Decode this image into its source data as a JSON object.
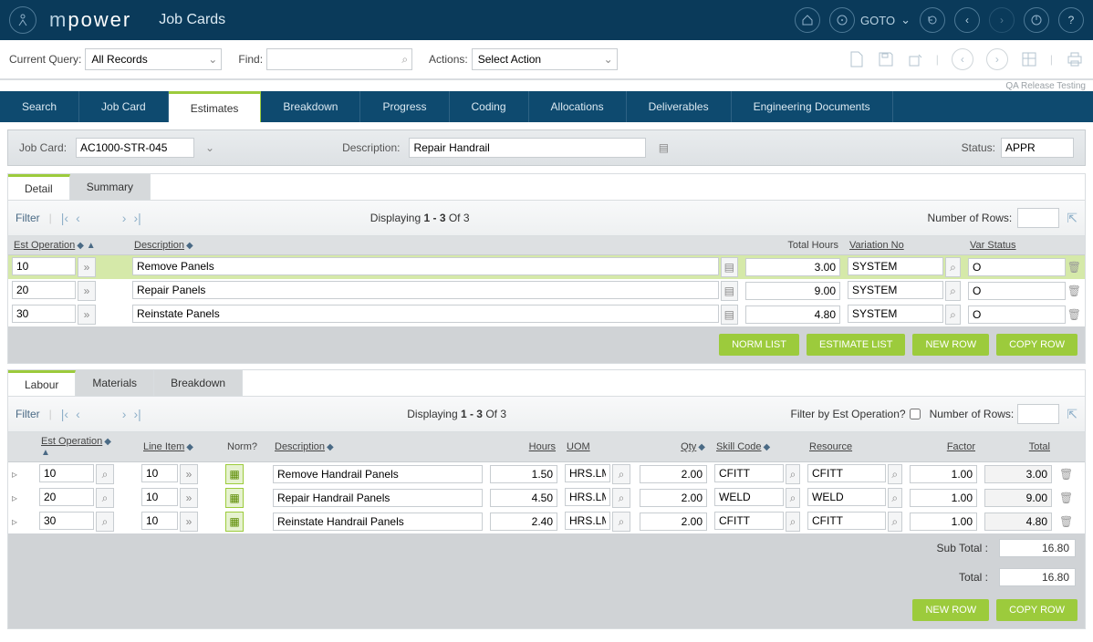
{
  "header": {
    "brand_prefix": "m",
    "brand": "power",
    "page_title": "Job Cards",
    "goto_label": "GOTO"
  },
  "querybar": {
    "current_query_label": "Current Query:",
    "current_query_value": "All Records",
    "find_label": "Find:",
    "find_value": "",
    "actions_label": "Actions:",
    "actions_value": "Select Action",
    "qa_label": "QA Release Testing"
  },
  "tabs": {
    "items": [
      "Search",
      "Job Card",
      "Estimates",
      "Breakdown",
      "Progress",
      "Coding",
      "Allocations",
      "Deliverables",
      "Engineering Documents"
    ],
    "active_index": 2
  },
  "record": {
    "jobcard_label": "Job Card:",
    "jobcard_value": "AC1000-STR-045",
    "description_label": "Description:",
    "description_value": "Repair Handrail",
    "status_label": "Status:",
    "status_value": "APPR"
  },
  "estimates_panel": {
    "subtabs": [
      "Detail",
      "Summary"
    ],
    "active_index": 0,
    "filter_label": "Filter",
    "displaying_prefix": "Displaying ",
    "displaying_range": "1 - 3",
    "displaying_suffix": " Of 3",
    "rows_label": "Number of Rows:",
    "headers": {
      "est_op": "Est Operation",
      "description": "Description",
      "total_hours": "Total Hours",
      "variation_no": "Variation No",
      "var_status": "Var Status"
    },
    "rows": [
      {
        "op": "10",
        "desc": "Remove Panels",
        "hours": "3.00",
        "variation": "SYSTEM",
        "status": "O"
      },
      {
        "op": "20",
        "desc": "Repair Panels",
        "hours": "9.00",
        "variation": "SYSTEM",
        "status": "O"
      },
      {
        "op": "30",
        "desc": "Reinstate Panels",
        "hours": "4.80",
        "variation": "SYSTEM",
        "status": "O"
      }
    ],
    "buttons": {
      "norm": "NORM LIST",
      "estimate": "ESTIMATE LIST",
      "newrow": "NEW ROW",
      "copy": "COPY ROW"
    }
  },
  "labour_panel": {
    "subtabs": [
      "Labour",
      "Materials",
      "Breakdown"
    ],
    "active_index": 0,
    "filter_label": "Filter",
    "displaying_prefix": "Displaying ",
    "displaying_range": "1 - 3",
    "displaying_suffix": " Of 3",
    "filter_est_label": "Filter by Est Operation?",
    "rows_label": "Number of Rows:",
    "headers": {
      "est_op": "Est Operation",
      "line_item": "Line Item",
      "norm": "Norm?",
      "description": "Description",
      "hours": "Hours",
      "uom": "UOM",
      "qty": "Qty",
      "skill": "Skill Code",
      "resource": "Resource",
      "factor": "Factor",
      "total": "Total"
    },
    "rows": [
      {
        "op": "10",
        "item": "10",
        "desc": "Remove Handrail Panels",
        "hours": "1.50",
        "uom": "HRS.LM",
        "qty": "2.00",
        "skill": "CFITT",
        "resource": "CFITT",
        "factor": "1.00",
        "total": "3.00"
      },
      {
        "op": "20",
        "item": "10",
        "desc": "Repair Handrail Panels",
        "hours": "4.50",
        "uom": "HRS.LM",
        "qty": "2.00",
        "skill": "WELD",
        "resource": "WELD",
        "factor": "1.00",
        "total": "9.00"
      },
      {
        "op": "30",
        "item": "10",
        "desc": "Reinstate Handrail Panels",
        "hours": "2.40",
        "uom": "HRS.LM",
        "qty": "2.00",
        "skill": "CFITT",
        "resource": "CFITT",
        "factor": "1.00",
        "total": "4.80"
      }
    ],
    "subtotal_label": "Sub Total :",
    "subtotal_value": "16.80",
    "total_label": "Total :",
    "total_value": "16.80",
    "buttons": {
      "newrow": "NEW ROW",
      "copy": "COPY ROW"
    }
  }
}
